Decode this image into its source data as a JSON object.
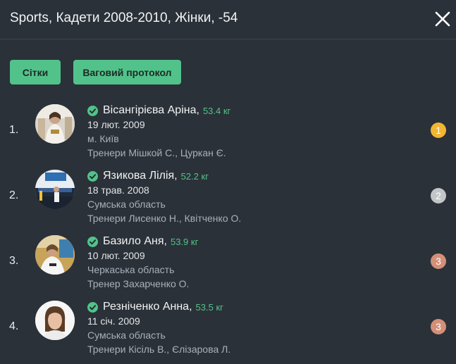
{
  "header": {
    "title": "Sports, Кадети 2008-2010, Жінки, -54"
  },
  "buttons": {
    "grids": "Сітки",
    "weigh_protocol": "Ваговий протокол"
  },
  "colors": {
    "accent": "#52c28b",
    "gold": "#f2b632",
    "silver": "#c3c6c9",
    "bronze": "#d48f78"
  },
  "athletes": [
    {
      "place": "1.",
      "name": "Вісангірієва Аріна,",
      "weight": "53.4 кг",
      "birth": "19 лют. 2009",
      "region": "м. Київ",
      "coach": "Тренери Мішкой С.,  Цуркан Є.",
      "medal": "1",
      "medal_color": "#f2b632"
    },
    {
      "place": "2.",
      "name": "Язикова Лілія,",
      "weight": "52.2 кг",
      "birth": "18 трав. 2008",
      "region": "Сумська область",
      "coach": "Тренери Лисенко Н.,  Квітченко О.",
      "medal": "2",
      "medal_color": "#c3c6c9"
    },
    {
      "place": "3.",
      "name": "Базило Аня,",
      "weight": "53.9 кг",
      "birth": "10 лют. 2009",
      "region": "Черкаська область",
      "coach": "Тренер Захарченко О.",
      "medal": "3",
      "medal_color": "#d48f78"
    },
    {
      "place": "4.",
      "name": "Резніченко Анна,",
      "weight": "53.5 кг",
      "birth": "11 січ. 2009",
      "region": "Сумська область",
      "coach": "Тренери Кісіль В.,  Єлізарова Л.",
      "medal": "3",
      "medal_color": "#d48f78"
    }
  ]
}
